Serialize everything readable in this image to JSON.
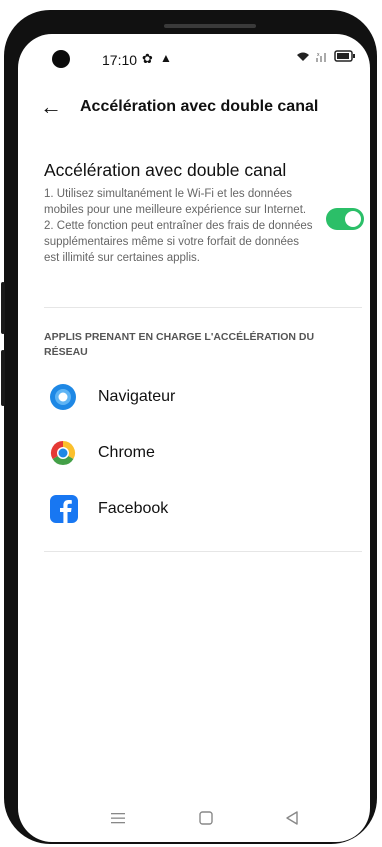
{
  "status_bar": {
    "time": "17:10",
    "settings_glyph": "✿",
    "warn_glyph": "▲"
  },
  "header": {
    "back_glyph": "←",
    "title": "Accélération avec double canal"
  },
  "setting": {
    "title": "Accélération avec double canal",
    "description": "1. Utilisez simultanément le Wi-Fi et les données mobiles pour une meilleure expérience sur Internet.\n2. Cette fonction peut entraîner des frais de données supplémentaires même si votre forfait de données est illimité sur certaines applis.",
    "enabled": true,
    "toggle_color": "#2bbf68"
  },
  "apps_section": {
    "label": "APPLIS PRENANT EN CHARGE L'ACCÉLÉRATION DU RÉSEAU",
    "apps": [
      {
        "label": "Navigateur",
        "icon": "browser-icon"
      },
      {
        "label": "Chrome",
        "icon": "chrome-icon"
      },
      {
        "label": "Facebook",
        "icon": "facebook-icon"
      }
    ]
  },
  "nav": {
    "menu_icon": "menu-icon",
    "home_icon": "home-icon",
    "back_icon": "back-triangle-icon"
  }
}
